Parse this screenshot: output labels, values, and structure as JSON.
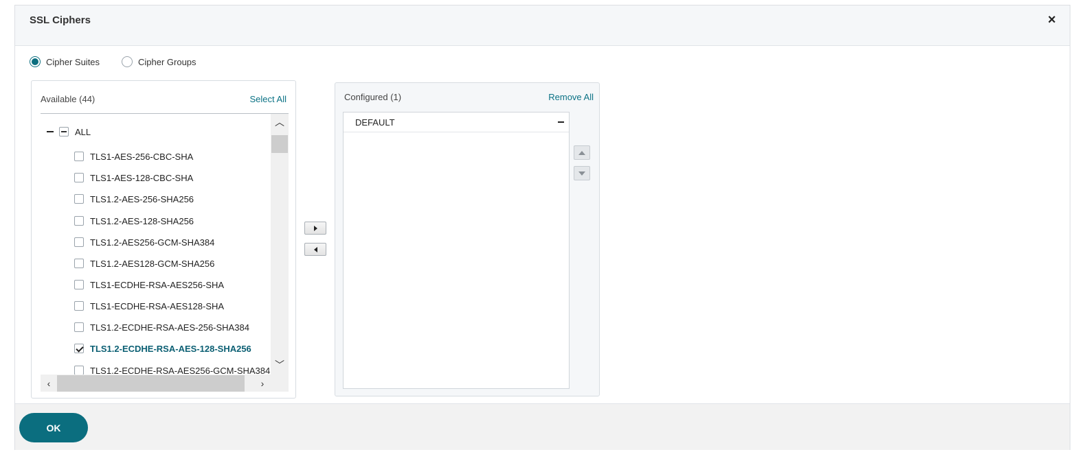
{
  "dialog": {
    "title": "SSL Ciphers",
    "close_icon": "close-icon"
  },
  "radio": {
    "selected": "cipher_suites",
    "cipher_suites": "Cipher Suites",
    "cipher_groups": "Cipher Groups"
  },
  "available": {
    "title": "Available (44)",
    "select_all": "Select All",
    "root_label": "ALL",
    "items": [
      {
        "label": "TLS1-AES-256-CBC-SHA",
        "checked": false
      },
      {
        "label": "TLS1-AES-128-CBC-SHA",
        "checked": false
      },
      {
        "label": "TLS1.2-AES-256-SHA256",
        "checked": false
      },
      {
        "label": "TLS1.2-AES-128-SHA256",
        "checked": false
      },
      {
        "label": "TLS1.2-AES256-GCM-SHA384",
        "checked": false
      },
      {
        "label": "TLS1.2-AES128-GCM-SHA256",
        "checked": false
      },
      {
        "label": "TLS1-ECDHE-RSA-AES256-SHA",
        "checked": false
      },
      {
        "label": "TLS1-ECDHE-RSA-AES128-SHA",
        "checked": false
      },
      {
        "label": "TLS1.2-ECDHE-RSA-AES-256-SHA384",
        "checked": false
      },
      {
        "label": "TLS1.2-ECDHE-RSA-AES-128-SHA256",
        "checked": true
      },
      {
        "label": "TLS1.2-ECDHE-RSA-AES256-GCM-SHA384",
        "checked": false
      }
    ]
  },
  "configured": {
    "title": "Configured (1)",
    "remove_all": "Remove All",
    "items": [
      {
        "label": "DEFAULT"
      }
    ]
  },
  "footer": {
    "ok_label": "OK"
  },
  "colors": {
    "accent": "#0b6e7f",
    "link": "#0b7285"
  }
}
